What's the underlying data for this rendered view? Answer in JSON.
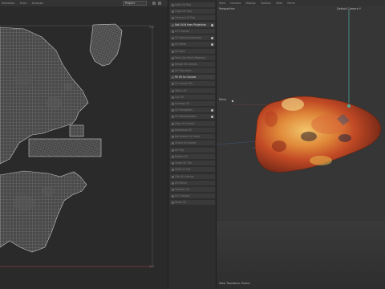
{
  "uv_editor": {
    "menu": [
      "Selection",
      "Form",
      "Analyze"
    ],
    "project_select": "Project",
    "corner_label_top": "1.0",
    "corner_label_bottom": "1.0"
  },
  "tools": [
    {
      "label": "Auto UV Proj",
      "hl": false,
      "chk": false
    },
    {
      "label": "Cage UV Proj",
      "hl": false,
      "chk": false
    },
    {
      "label": "Camera UV Proj",
      "hl": false,
      "chk": false
    },
    {
      "label": "Set UV-N from Projection",
      "hl": true,
      "chk": true
    },
    {
      "label": "UV Unwrap",
      "hl": false,
      "chk": false
    },
    {
      "label": "UV Seams Automatic",
      "hl": false,
      "chk": true
    },
    {
      "label": "UV Relax",
      "hl": false,
      "chk": true
    },
    {
      "label": "UV Pack",
      "hl": false,
      "chk": false
    },
    {
      "label": "Pack UVs Multi-Mapping",
      "hl": false,
      "chk": false
    },
    {
      "label": "Merge UV Islands",
      "hl": false,
      "chk": false
    },
    {
      "label": "UV Transform",
      "hl": false,
      "chk": false
    },
    {
      "label": "Fit UV to Canvas",
      "hl": true,
      "chk": false
    },
    {
      "label": "UV Layout 3D",
      "hl": false,
      "chk": false
    },
    {
      "label": "Stitch UV",
      "hl": false,
      "chk": false
    },
    {
      "label": "Cut UV",
      "hl": false,
      "chk": false
    },
    {
      "label": "Unwrap UV",
      "hl": false,
      "chk": false
    },
    {
      "label": "UV Straighten",
      "hl": false,
      "chk": true
    },
    {
      "label": "UV Rectangulate",
      "hl": false,
      "chk": true
    },
    {
      "label": "Align UV Island",
      "hl": false,
      "chk": false
    },
    {
      "label": "Distribute UV",
      "hl": false,
      "chk": false
    },
    {
      "label": "Normalize UV Scale",
      "hl": false,
      "chk": false
    },
    {
      "label": "Orient UV Island",
      "hl": false,
      "chk": false
    },
    {
      "label": "UV Flip",
      "hl": false,
      "chk": false
    },
    {
      "label": "Rotate UV",
      "hl": false,
      "chk": false
    },
    {
      "label": "Scale UV Tile",
      "hl": false,
      "chk": false
    },
    {
      "label": "Shift UV Tile",
      "hl": false,
      "chk": false
    },
    {
      "label": "Tile UV Islands",
      "hl": false,
      "chk": false
    },
    {
      "label": "UV Mirror",
      "hl": false,
      "chk": false
    },
    {
      "label": "Transfer UV",
      "hl": false,
      "chk": false
    },
    {
      "label": "UV Checker",
      "hl": false,
      "chk": false
    },
    {
      "label": "Show UV",
      "hl": false,
      "chk": false
    }
  ],
  "viewport": {
    "menu": [
      "View",
      "Camera",
      "Display",
      "Options",
      "Filter",
      "Panel"
    ],
    "view_name": "Perspective",
    "camera_label": "Default Camera Y",
    "move_label": "Move",
    "status": "View Transform: Scene"
  },
  "colors": {
    "accent": "#4fb0a0",
    "uv_line": "#b0b0b0"
  }
}
